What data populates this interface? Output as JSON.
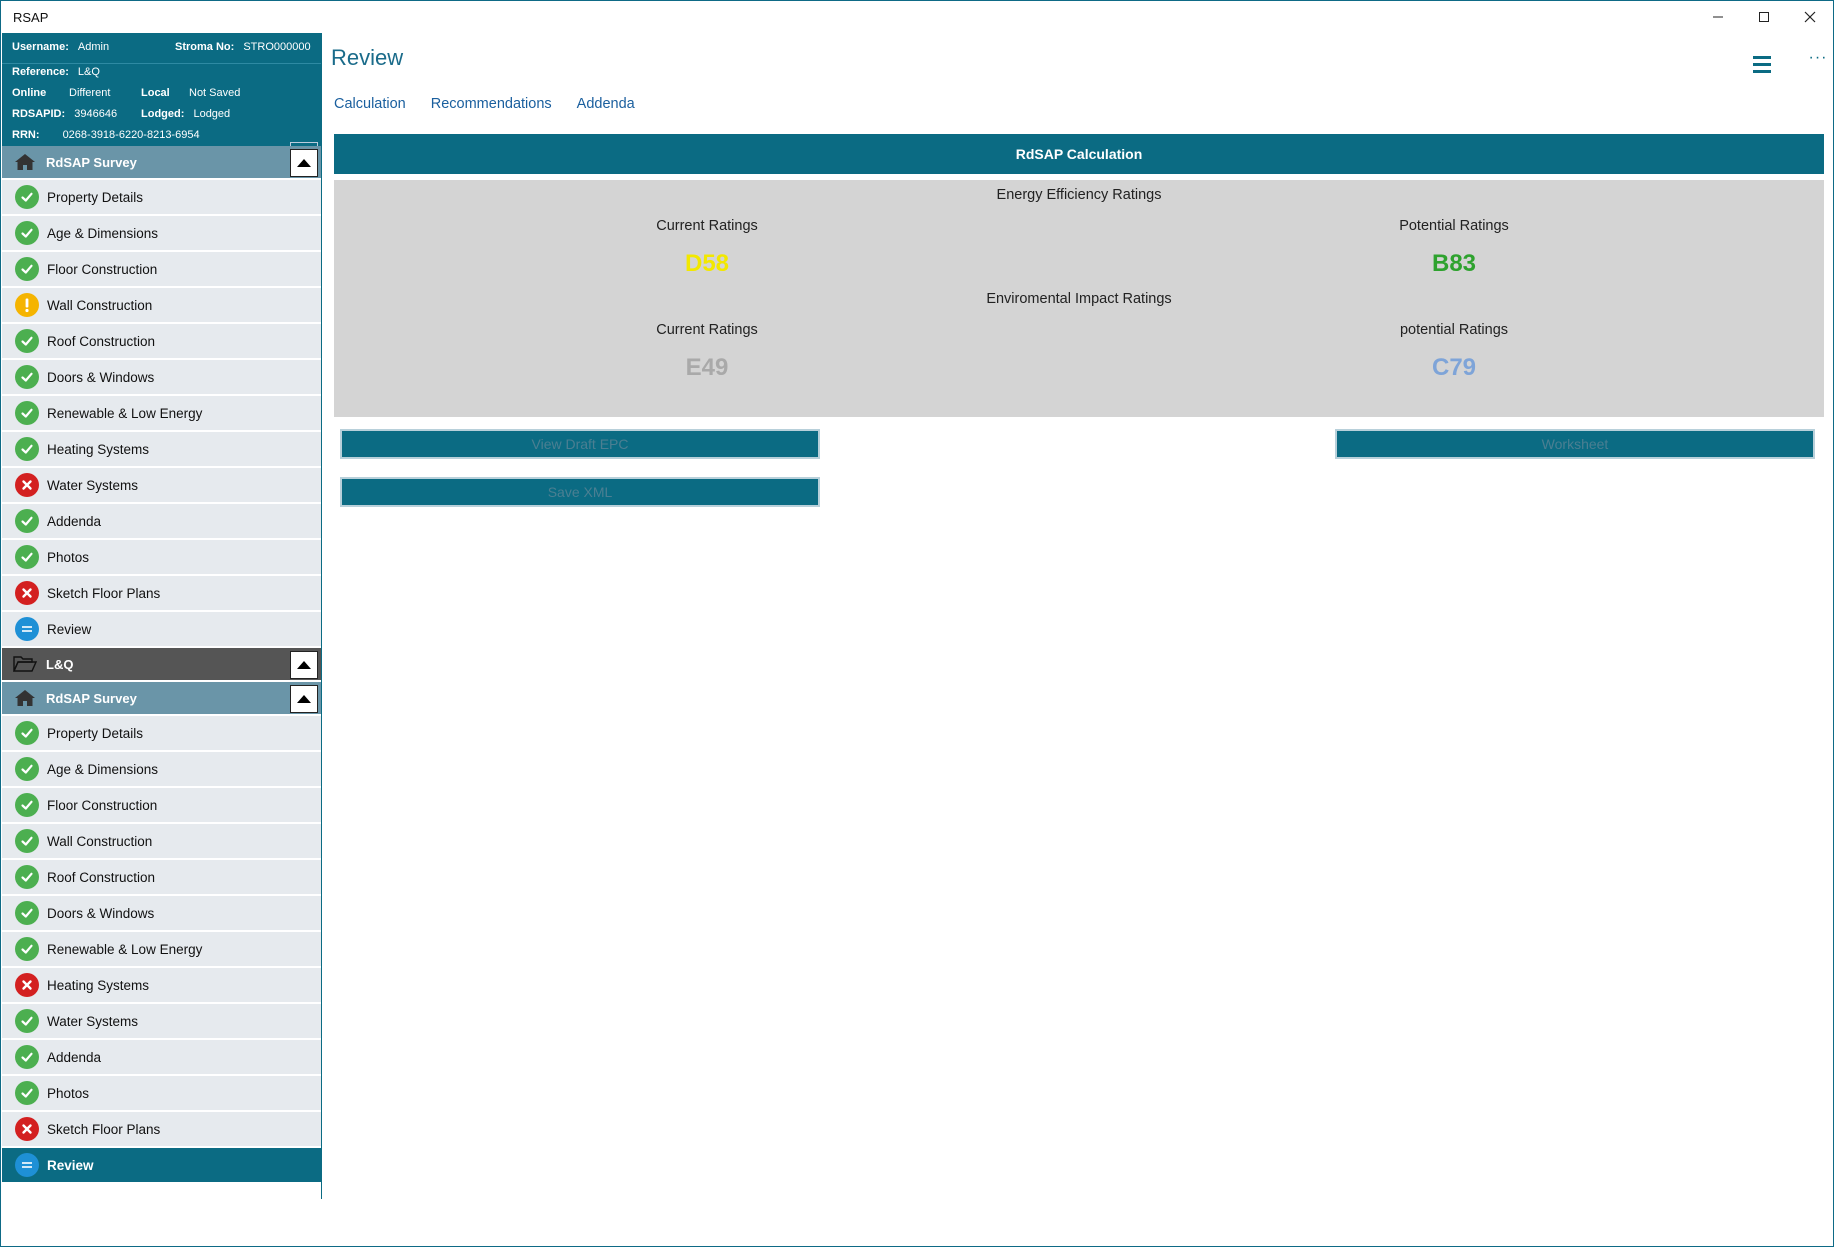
{
  "window": {
    "title": "RSAP",
    "minimize_symbol": "—",
    "maximize_symbol": "☐",
    "close_symbol": "✕"
  },
  "info": {
    "username_label": "Username:",
    "username": "Admin",
    "stroma_label": "Stroma No:",
    "stroma": "STRO000000",
    "reference_label": "Reference:",
    "reference": "L&Q",
    "online_label": "Online",
    "online": "Different",
    "local_label": "Local",
    "local": "Not Saved",
    "rdsapid_label": "RDSAPID:",
    "rdsapid": "3946646",
    "lodged_label": "Lodged:",
    "lodged": "Lodged",
    "rrn_label": "RRN:",
    "rrn": "0268-3918-6220-8213-6954"
  },
  "nav": {
    "survey1": {
      "title": "RdSAP Survey",
      "items": [
        {
          "label": "Property Details",
          "status": "ok"
        },
        {
          "label": "Age & Dimensions",
          "status": "ok"
        },
        {
          "label": "Floor Construction",
          "status": "ok"
        },
        {
          "label": "Wall Construction",
          "status": "warn"
        },
        {
          "label": "Roof Construction",
          "status": "ok"
        },
        {
          "label": "Doors & Windows",
          "status": "ok"
        },
        {
          "label": "Renewable & Low Energy",
          "status": "ok"
        },
        {
          "label": "Heating Systems",
          "status": "ok"
        },
        {
          "label": "Water Systems",
          "status": "err"
        },
        {
          "label": "Addenda",
          "status": "ok"
        },
        {
          "label": "Photos",
          "status": "ok"
        },
        {
          "label": "Sketch Floor Plans",
          "status": "err"
        },
        {
          "label": "Review",
          "status": "cur"
        }
      ]
    },
    "folder": {
      "title": "L&Q"
    },
    "survey2": {
      "title": "RdSAP Survey",
      "items": [
        {
          "label": "Property Details",
          "status": "ok"
        },
        {
          "label": "Age & Dimensions",
          "status": "ok"
        },
        {
          "label": "Floor Construction",
          "status": "ok"
        },
        {
          "label": "Wall Construction",
          "status": "ok"
        },
        {
          "label": "Roof Construction",
          "status": "ok"
        },
        {
          "label": "Doors & Windows",
          "status": "ok"
        },
        {
          "label": "Renewable & Low Energy",
          "status": "ok"
        },
        {
          "label": "Heating Systems",
          "status": "err"
        },
        {
          "label": "Water Systems",
          "status": "ok"
        },
        {
          "label": "Addenda",
          "status": "ok"
        },
        {
          "label": "Photos",
          "status": "ok"
        },
        {
          "label": "Sketch Floor Plans",
          "status": "err"
        },
        {
          "label": "Review",
          "status": "cur",
          "active": true
        }
      ]
    }
  },
  "main": {
    "title": "Review",
    "tabs": [
      "Calculation",
      "Recommendations",
      "Addenda"
    ],
    "calc_header": "RdSAP Calculation",
    "energy_title": "Energy Efficiency Ratings",
    "energy_current_label": "Current Ratings",
    "energy_current_value": "D58",
    "energy_potential_label": "Potential Ratings",
    "energy_potential_value": "B83",
    "env_title": "Enviromental Impact Ratings",
    "env_current_label": "Current Ratings",
    "env_current_value": "E49",
    "env_potential_label": "potential Ratings",
    "env_potential_value": "C79",
    "buttons": {
      "view_draft_epc": "View Draft EPC",
      "worksheet": "Worksheet",
      "save_xml": "Save XML"
    }
  },
  "colors": {
    "accent": "#0b6b83",
    "d_rating": "#f2e800",
    "b_rating": "#2ea22e",
    "e_rating": "#a9a9a9",
    "c_rating": "#7ea4d8",
    "ok": "#4caf50",
    "warn": "#f5b400",
    "err": "#d32020",
    "current": "#1e90d6"
  }
}
